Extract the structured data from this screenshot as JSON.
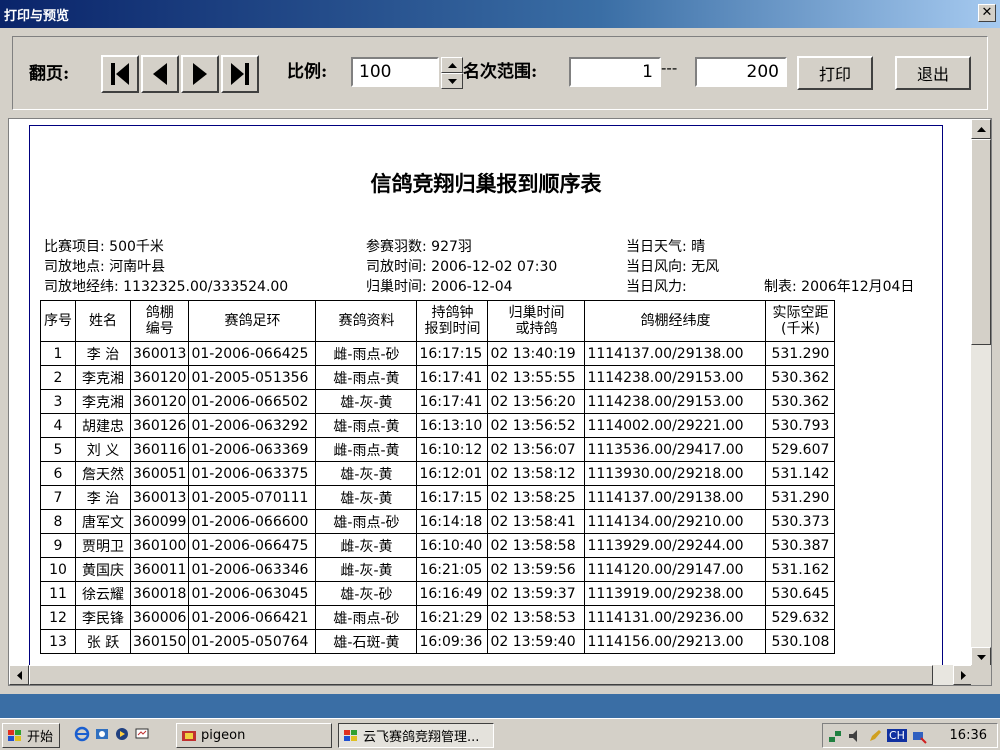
{
  "window": {
    "title": "打印与预览",
    "close_glyph": "✕"
  },
  "toolbar": {
    "page_label": "翻页:",
    "scale_label": "比例:",
    "scale_value": "100",
    "rank_label": "名次范围:",
    "rank_from": "1",
    "rank_sep": "---",
    "rank_to": "200",
    "print_label": "打印",
    "exit_label": "退出"
  },
  "report": {
    "title": "信鸽竞翔归巢报到顺序表",
    "info": {
      "event": "比赛项目: 500千米",
      "release_place": "司放地点: 河南叶县",
      "release_coord": "司放地经纬: 1132325.00/333524.00",
      "entries": "参赛羽数: 927羽",
      "release_time": "司放时间: 2006-12-02  07:30",
      "return_time": "归巢时间: 2006-12-04",
      "weather": "当日天气: 晴",
      "wind_dir": "当日风向: 无风",
      "wind_force": "当日风力:",
      "made": "制表: 2006年12月04日"
    },
    "headers": {
      "h0": "序号",
      "h1": "姓名",
      "h2a": "鸽棚",
      "h2b": "编号",
      "h3": "赛鸽足环",
      "h4": "赛鸽资料",
      "h5a": "持鸽钟",
      "h5b": "报到时间",
      "h6a": "归巢时间",
      "h6b": "或持鸽",
      "h7": "鸽棚经纬度",
      "h8a": "实际空距",
      "h8b": "(千米)"
    },
    "rows": [
      [
        "1",
        "李  治",
        "360013",
        "01-2006-066425",
        "雌-雨点-砂",
        "16:17:15",
        "02 13:40:19",
        "1114137.00/29138.00",
        "531.290"
      ],
      [
        "2",
        "李克湘",
        "360120",
        "01-2005-051356",
        "雄-雨点-黄",
        "16:17:41",
        "02 13:55:55",
        "1114238.00/29153.00",
        "530.362"
      ],
      [
        "3",
        "李克湘",
        "360120",
        "01-2006-066502",
        "雄-灰-黄",
        "16:17:41",
        "02 13:56:20",
        "1114238.00/29153.00",
        "530.362"
      ],
      [
        "4",
        "胡建忠",
        "360126",
        "01-2006-063292",
        "雄-雨点-黄",
        "16:13:10",
        "02 13:56:52",
        "1114002.00/29221.00",
        "530.793"
      ],
      [
        "5",
        "刘  义",
        "360116",
        "01-2006-063369",
        "雌-雨点-黄",
        "16:10:12",
        "02 13:56:07",
        "1113536.00/29417.00",
        "529.607"
      ],
      [
        "6",
        "詹天然",
        "360051",
        "01-2006-063375",
        "雄-灰-黄",
        "16:12:01",
        "02 13:58:12",
        "1113930.00/29218.00",
        "531.142"
      ],
      [
        "7",
        "李  治",
        "360013",
        "01-2005-070111",
        "雄-灰-黄",
        "16:17:15",
        "02 13:58:25",
        "1114137.00/29138.00",
        "531.290"
      ],
      [
        "8",
        "唐军文",
        "360099",
        "01-2006-066600",
        "雄-雨点-砂",
        "16:14:18",
        "02 13:58:41",
        "1114134.00/29210.00",
        "530.373"
      ],
      [
        "9",
        "贾明卫",
        "360100",
        "01-2006-066475",
        "雌-灰-黄",
        "16:10:40",
        "02 13:58:58",
        "1113929.00/29244.00",
        "530.387"
      ],
      [
        "10",
        "黄国庆",
        "360011",
        "01-2006-063346",
        "雌-灰-黄",
        "16:21:05",
        "02 13:59:56",
        "1114120.00/29147.00",
        "531.162"
      ],
      [
        "11",
        "徐云耀",
        "360018",
        "01-2006-063045",
        "雄-灰-砂",
        "16:16:49",
        "02 13:59:37",
        "1113919.00/29238.00",
        "530.645"
      ],
      [
        "12",
        "李民锋",
        "360006",
        "01-2006-066421",
        "雄-雨点-砂",
        "16:21:29",
        "02 13:58:53",
        "1114131.00/29236.00",
        "529.632"
      ],
      [
        "13",
        "张  跃",
        "360150",
        "01-2005-050764",
        "雄-石斑-黄",
        "16:09:36",
        "02 13:59:40",
        "1114156.00/29213.00",
        "530.108"
      ]
    ]
  },
  "taskbar": {
    "start_label": "开始",
    "task1": "pigeon",
    "task2": "云飞赛鸽竞翔管理...",
    "tray_lang": "CH",
    "clock": "16:36"
  }
}
